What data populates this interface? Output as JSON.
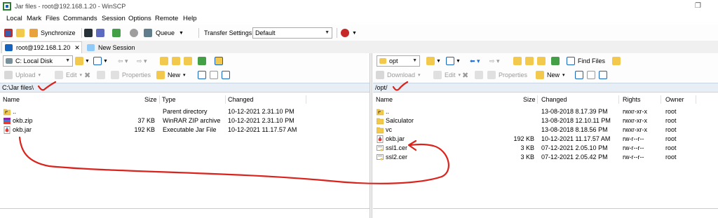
{
  "window": {
    "title": "Jar files - root@192.168.1.20 - WinSCP"
  },
  "menu": [
    "Local",
    "Mark",
    "Files",
    "Commands",
    "Session",
    "Options",
    "Remote",
    "Help"
  ],
  "toolbar": {
    "synchronize": "Synchronize",
    "queue": "Queue",
    "transfer_label": "Transfer Settings",
    "transfer_value": "Default"
  },
  "tabs": {
    "session": "root@192.168.1.20",
    "new_session": "New Session"
  },
  "local": {
    "drive": "C: Local Disk",
    "upload": "Upload",
    "edit": "Edit",
    "properties": "Properties",
    "new": "New",
    "path": "C:\\Jar files\\",
    "headers": {
      "name": "Name",
      "size": "Size",
      "type": "Type",
      "changed": "Changed"
    },
    "files": [
      {
        "name": "..",
        "size": "",
        "type": "Parent directory",
        "changed": "10-12-2021  2.31.10 PM",
        "icon": "parent-dir-icon"
      },
      {
        "name": "okb.zip",
        "size": "37 KB",
        "type": "WinRAR ZIP archive",
        "changed": "10-12-2021  2.31.10 PM",
        "icon": "zip-icon"
      },
      {
        "name": "okb.jar",
        "size": "192 KB",
        "type": "Executable Jar File",
        "changed": "10-12-2021  11.17.57 AM",
        "icon": "jar-icon"
      }
    ]
  },
  "remote": {
    "folder": "opt",
    "find_files": "Find Files",
    "download": "Download",
    "edit": "Edit",
    "properties": "Properties",
    "new": "New",
    "path": "/opt/",
    "headers": {
      "name": "Name",
      "size": "Size",
      "changed": "Changed",
      "rights": "Rights",
      "owner": "Owner"
    },
    "files": [
      {
        "name": "..",
        "size": "",
        "changed": "13-08-2018  8.17.39 PM",
        "rights": "rwxr-xr-x",
        "owner": "root",
        "icon": "parent-dir-icon"
      },
      {
        "name": "Salculator",
        "size": "",
        "changed": "13-08-2018  12.10.11 PM",
        "rights": "rwxr-xr-x",
        "owner": "root",
        "icon": "folder-icon"
      },
      {
        "name": "vc",
        "size": "",
        "changed": "13-08-2018  8.18.56 PM",
        "rights": "rwxr-xr-x",
        "owner": "root",
        "icon": "folder-icon"
      },
      {
        "name": "okb.jar",
        "size": "192 KB",
        "changed": "10-12-2021  11.17.57 AM",
        "rights": "rw-r--r--",
        "owner": "root",
        "icon": "jar-icon"
      },
      {
        "name": "ssl1.cer",
        "size": "3 KB",
        "changed": "07-12-2021  2.05.10 PM",
        "rights": "rw-r--r--",
        "owner": "root",
        "icon": "cert-icon"
      },
      {
        "name": "ssl2.cer",
        "size": "3 KB",
        "changed": "07-12-2021  2.05.42 PM",
        "rights": "rw-r--r--",
        "owner": "root",
        "icon": "cert-icon"
      }
    ]
  },
  "colors": {
    "annotation": "#d9231c",
    "path_bg": "#e8eef6",
    "folder": "#f2c94c"
  }
}
